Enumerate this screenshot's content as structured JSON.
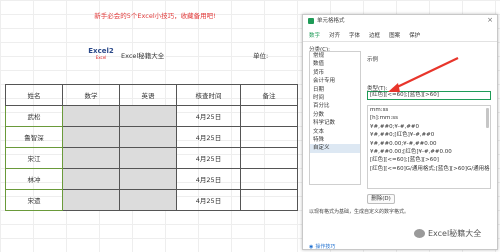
{
  "sheet": {
    "banner": "新手必会的5个Excel小技巧，收藏备用吧!",
    "logo_main": "Excel2",
    "logo_sub": "Excel",
    "brand": "Excel秘籍大全",
    "unit_label": "单位:",
    "table": {
      "headers": [
        "姓名",
        "数学",
        "英语",
        "核查时间",
        "备注"
      ],
      "rows": [
        {
          "name": "武松",
          "date": "4月25日"
        },
        {
          "name": "鲁智深",
          "date": "4月25日"
        },
        {
          "name": "宋江",
          "date": "4月25日"
        },
        {
          "name": "林冲",
          "date": "4月25日"
        },
        {
          "name": "宋遗",
          "date": "4月25日"
        }
      ]
    }
  },
  "dialog": {
    "title": "单元格格式",
    "close": "×",
    "tabs": [
      "数字",
      "对齐",
      "字体",
      "边框",
      "图案",
      "保护"
    ],
    "category_label": "分类(C):",
    "categories": [
      "常规",
      "数值",
      "货币",
      "会计专用",
      "日期",
      "时间",
      "百分比",
      "分数",
      "科学记数",
      "文本",
      "特殊",
      "自定义"
    ],
    "sample_label": "示例",
    "type_label": "类型(T):",
    "type_value": "[红色][<=60];[蓝色][>60]",
    "formats": [
      "mm:ss",
      "[h]:mm:ss",
      "¥#,##0;¥-#,##0",
      "¥#,##0;[红色]¥-#,##0",
      "¥#,##0.00;¥-#,##0.00",
      "¥#,##0.00;[红色]¥-#,##0.00",
      "[红色][<=60];[蓝色][>60]",
      "[红色][<=60]G/通用格式;[蓝色][>60]G/通用格"
    ],
    "delete_button": "删除(D)",
    "description": "以现有格式为基础，生成自定义的数字格式。",
    "tips": "操作技巧"
  },
  "watermark": "Excel秘籍大全"
}
